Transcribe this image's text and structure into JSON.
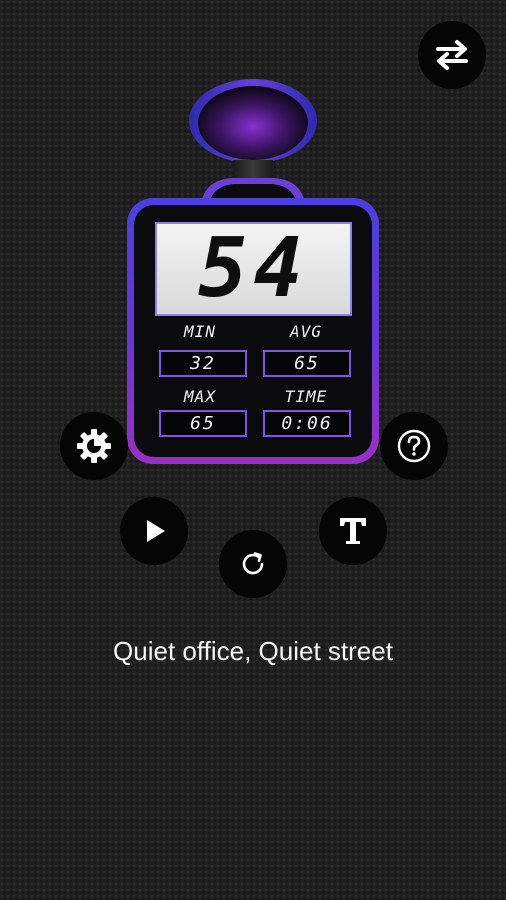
{
  "meter": {
    "current_value": "54",
    "stats": {
      "min_label": "MIN",
      "min_value": "32",
      "avg_label": "AVG",
      "avg_value": "65",
      "max_label": "MAX",
      "max_value": "65",
      "time_label": "TIME",
      "time_value": "0:06"
    }
  },
  "status": {
    "description": "Quiet office, Quiet street"
  },
  "controls": {
    "swap_icon": "swap-arrows-icon",
    "settings_icon": "gear-icon",
    "help_icon": "question-mark-icon",
    "play_icon": "play-icon",
    "reset_icon": "refresh-icon",
    "text_icon": "text-t-icon"
  },
  "colors": {
    "accent_blue": "#4b3fe0",
    "accent_purple": "#9b2fc8",
    "lcd_background": "#e8e8e8",
    "background": "#1f1f1f"
  }
}
